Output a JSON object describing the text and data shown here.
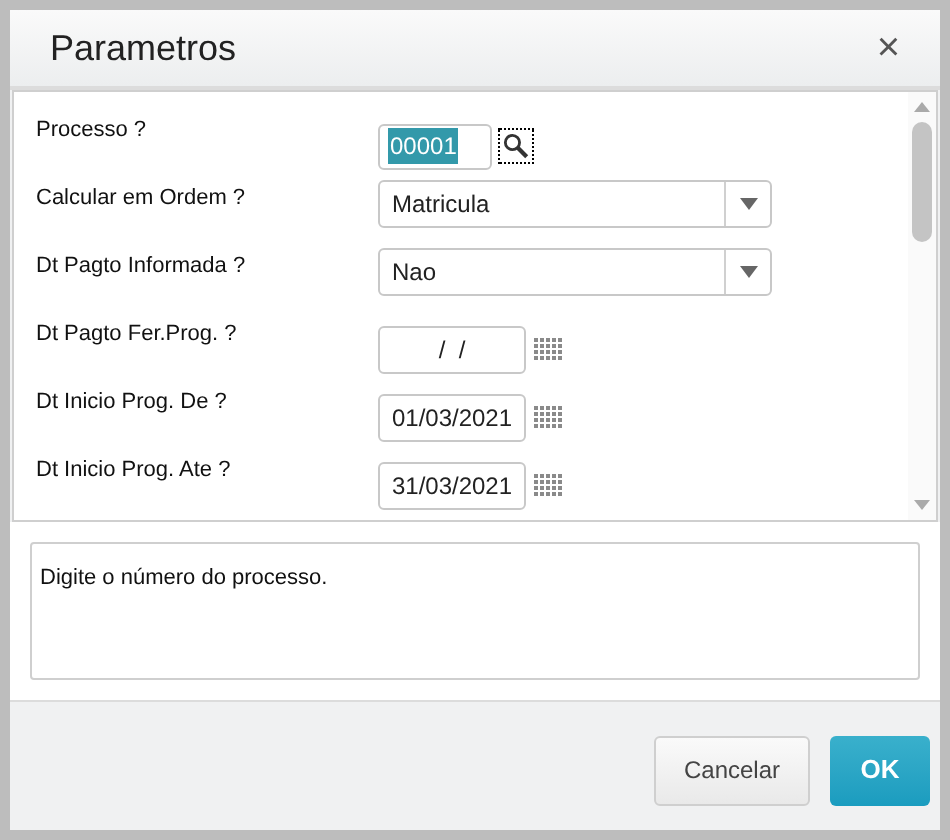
{
  "window": {
    "title": "Parametros",
    "close": "×"
  },
  "fields": [
    {
      "kind": "lookup",
      "label": "Processo ?",
      "value": "00001",
      "highlighted": true
    },
    {
      "kind": "select",
      "label": "Calcular em Ordem ?",
      "value": "Matricula"
    },
    {
      "kind": "select",
      "label": "Dt Pagto Informada ?",
      "value": "Nao"
    },
    {
      "kind": "date",
      "label": "Dt Pagto Fer.Prog. ?",
      "value": "/  /"
    },
    {
      "kind": "date",
      "label": "Dt Inicio Prog. De ?",
      "value": "01/03/2021"
    },
    {
      "kind": "date",
      "label": "Dt Inicio Prog. Ate ?",
      "value": "31/03/2021"
    }
  ],
  "help_text": "Digite o número do processo.",
  "buttons": [
    {
      "kind": "secondary",
      "label": "Cancelar"
    },
    {
      "kind": "primary",
      "label": "OK"
    }
  ]
}
